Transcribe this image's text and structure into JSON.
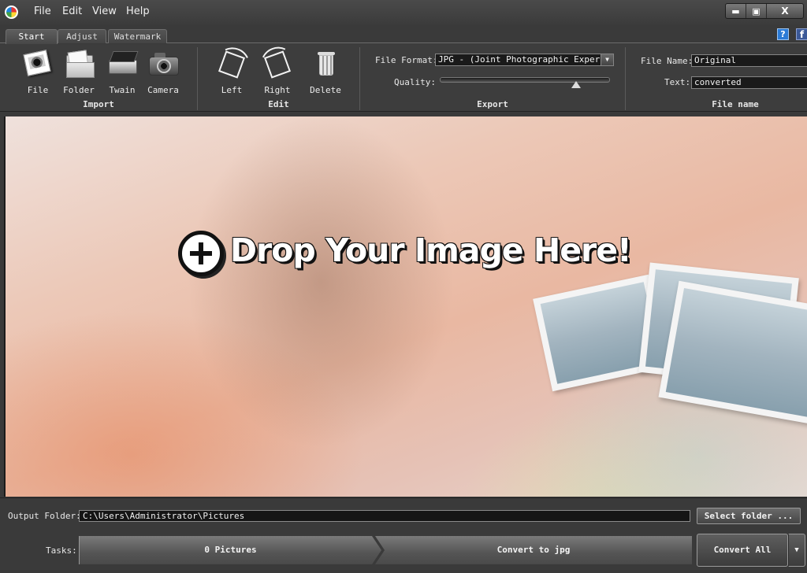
{
  "menu": {
    "file": "File",
    "edit": "Edit",
    "view": "View",
    "help": "Help"
  },
  "window_controls": {
    "minimize": "▬",
    "maximize": "▣",
    "close": "X"
  },
  "tabs": [
    "Start",
    "Adjust",
    "Watermark"
  ],
  "active_tab": "Start",
  "header_icons": {
    "help": "?",
    "facebook": "f"
  },
  "ribbon": {
    "import": {
      "label": "Import",
      "tools": [
        "File",
        "Folder",
        "Twain",
        "Camera"
      ]
    },
    "edit": {
      "label": "Edit",
      "tools": [
        "Left",
        "Right",
        "Delete"
      ]
    },
    "export": {
      "label": "Export",
      "file_format_label": "File Format:",
      "file_format_value": "JPG - (Joint Photographic Experts",
      "quality_label": "Quality:",
      "quality_percent": 80
    },
    "file_name": {
      "label": "File name",
      "file_name_label": "File Name:",
      "file_name_value": "Original",
      "text_label": "Text:",
      "text_value": "converted"
    }
  },
  "drop_area": {
    "text": "Drop Your Image Here!"
  },
  "bottom": {
    "output_folder_label": "Output Folder:",
    "output_folder_value": "C:\\Users\\Administrator\\Pictures",
    "select_folder": "Select folder ...",
    "tasks_label": "Tasks:",
    "task_pictures": "0 Pictures",
    "task_convert": "Convert to jpg",
    "convert_all": "Convert All"
  },
  "icons": {
    "app": "app-logo-icon",
    "file": "photo-icon",
    "folder": "folder-icon",
    "twain": "scanner-icon",
    "camera": "camera-icon",
    "left": "rotate-left-icon",
    "right": "rotate-right-icon",
    "delete": "trash-icon",
    "drop": "plus-circle-icon"
  }
}
